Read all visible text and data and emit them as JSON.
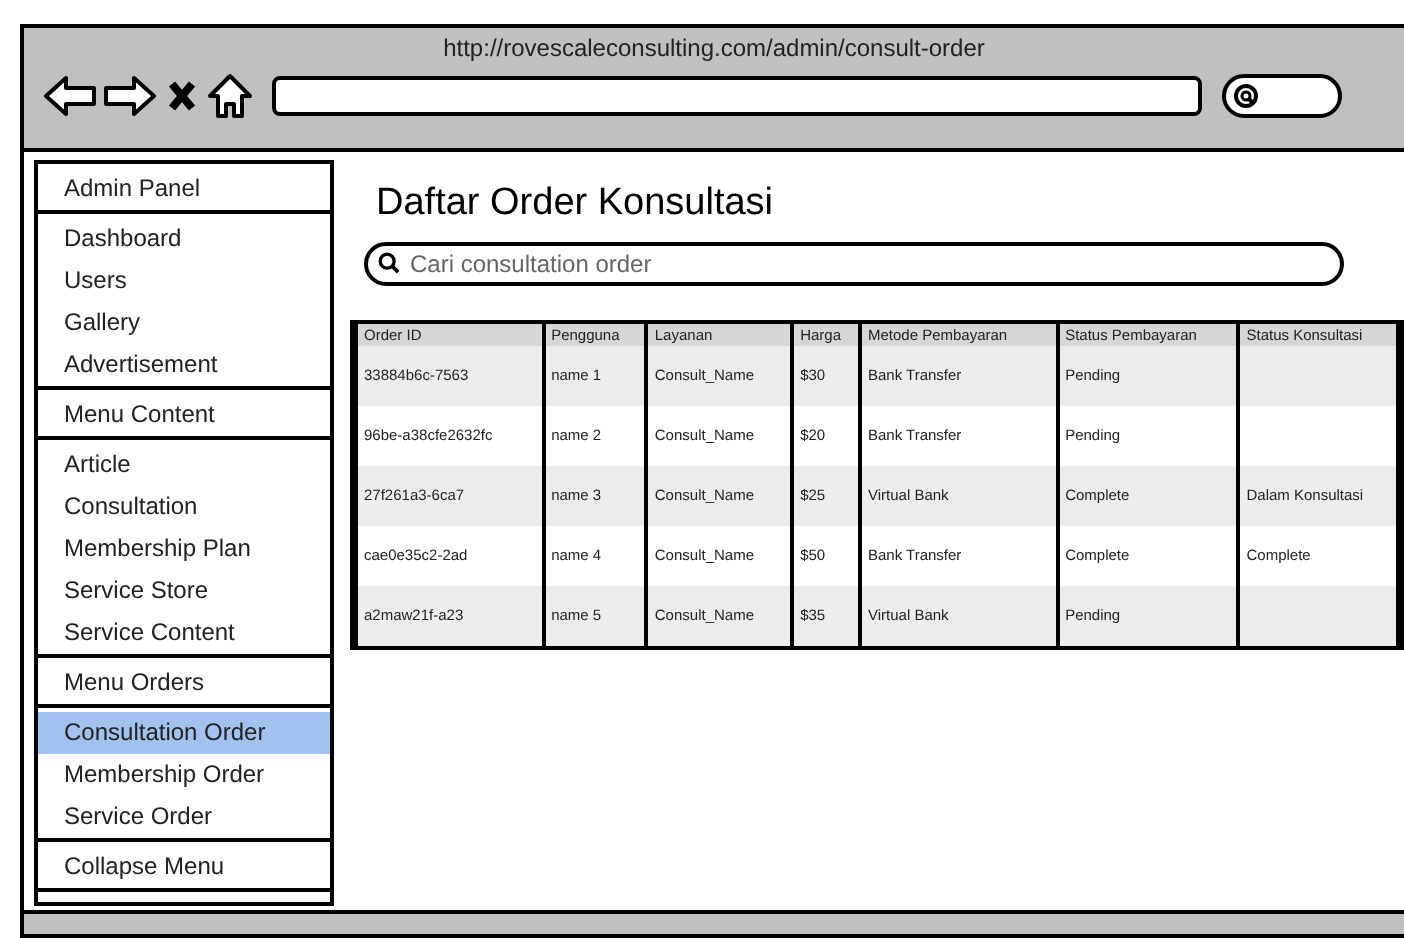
{
  "window": {
    "title": "http://rovescaleconsulting.com/admin/consult-order"
  },
  "sidebar": {
    "items": [
      {
        "label": "Admin Panel",
        "selected": false,
        "divider_below": true
      },
      {
        "label": "Dashboard",
        "selected": false,
        "divider_below": false
      },
      {
        "label": "Users",
        "selected": false,
        "divider_below": false
      },
      {
        "label": "Gallery",
        "selected": false,
        "divider_below": false
      },
      {
        "label": "Advertisement",
        "selected": false,
        "divider_below": true
      },
      {
        "label": "Menu Content",
        "selected": false,
        "divider_below": true
      },
      {
        "label": "Article",
        "selected": false,
        "divider_below": false
      },
      {
        "label": "Consultation",
        "selected": false,
        "divider_below": false
      },
      {
        "label": "Membership Plan",
        "selected": false,
        "divider_below": false
      },
      {
        "label": "Service Store",
        "selected": false,
        "divider_below": false
      },
      {
        "label": "Service Content",
        "selected": false,
        "divider_below": true
      },
      {
        "label": "Menu Orders",
        "selected": false,
        "divider_below": true
      },
      {
        "label": "Consultation Order",
        "selected": true,
        "divider_below": false
      },
      {
        "label": "Membership Order",
        "selected": false,
        "divider_below": false
      },
      {
        "label": "Service Order",
        "selected": false,
        "divider_below": true
      },
      {
        "label": "Collapse Menu",
        "selected": false,
        "divider_below": true
      }
    ]
  },
  "page_title": "Daftar Order Konsultasi",
  "search": {
    "placeholder": "Cari consultation order"
  },
  "table": {
    "columns": [
      "Order ID",
      "Pengguna",
      "Layanan",
      "Harga",
      "Metode Pembayaran",
      "Status Pembayaran",
      "Status Konsultasi"
    ],
    "rows": [
      [
        "33884b6c-7563",
        "name 1",
        "Consult_Name",
        "$30",
        "Bank Transfer",
        "Pending",
        ""
      ],
      [
        "96be-a38cfe2632fc",
        "name 2",
        "Consult_Name",
        "$20",
        "Bank Transfer",
        "Pending",
        ""
      ],
      [
        "27f261a3-6ca7",
        "name 3",
        "Consult_Name",
        "$25",
        "Virtual Bank",
        "Complete",
        "Dalam Konsultasi"
      ],
      [
        "cae0e35c2-2ad",
        "name 4",
        "Consult_Name",
        "$50",
        "Bank Transfer",
        "Complete",
        "Complete"
      ],
      [
        "a2maw21f-a23",
        "name 5",
        "Consult_Name",
        "$35",
        "Virtual Bank",
        "Pending",
        ""
      ]
    ]
  }
}
